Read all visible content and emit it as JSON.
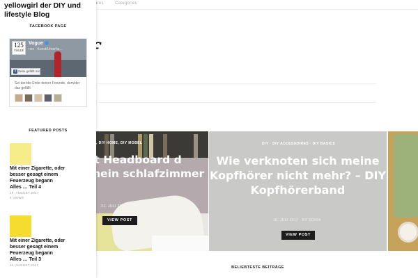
{
  "topnav": {
    "items": [
      "ares",
      "Categories"
    ]
  },
  "header": {
    "logo_fragment": "f"
  },
  "sidebar": {
    "blog_title": "yellowgirl der DIY und lifestyle Blog",
    "facebook_widget": {
      "title": "FACEBOOK PAGE",
      "page_name": "Vogue",
      "page_sub": "nes · Kunst/Unterha...",
      "logo_text": "125",
      "logo_sub": "VOGUE",
      "like_button": "Seite gefällt mir",
      "friends_text": "Sei der/die Erste deiner Freunde, dem/der das gefällt"
    },
    "featured": {
      "title": "FEATURED POSTS",
      "posts": [
        {
          "title": "Mit einer Zigarette, oder besser gesagt einem Feuerzeug begann Alles … Teil 4",
          "date": "19. AUGUST 2017",
          "views": "4 VIEWS",
          "thumb_color": "#f7ec8a"
        },
        {
          "title": "Mit einer Zigarette, oder besser gesagt einem Feuerzeug begann Alles … Teil 3",
          "date": "11. AUGUST 2017",
          "thumb_color": "#f6dc2e"
        }
      ]
    }
  },
  "slider": {
    "slides": [
      {
        "categories": ", DIY HOME, DIY MOBEL",
        "title": "tt Headboard d mein schlafzimmer",
        "meta": "21. JULI 2017 · BY SONIA",
        "button": "VIEW POST"
      },
      {
        "categories": "DIY · DIY ACCESSOIRES · DIY BASICS",
        "title": "Wie verknoten sich meine Kopfhörer nicht mehr? – DIY Kopfhörerband",
        "meta": "16. JULI 2017 · BY SONIA",
        "button": "VIEW POST"
      }
    ]
  },
  "section": {
    "beliebteste_title": "BELIEBTESTE BEITRÄGE"
  },
  "colors": {
    "accent": "#1d1d1d",
    "facebook": "#3b5998",
    "highlight_yellow": "#f6dc2e"
  }
}
